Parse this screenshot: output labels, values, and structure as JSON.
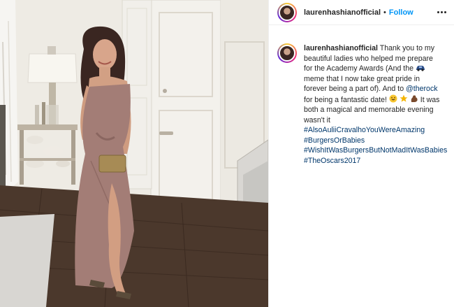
{
  "post": {
    "username": "laurenhashianofficial",
    "separator": "•",
    "follow_label": "Follow",
    "more_icon": "more-horizontal-icon"
  },
  "caption": {
    "username": "laurenhashianofficial",
    "text_1": " Thank you to my beautiful ladies who helped me prepare for the Academy Awards (And the ",
    "emoji_1": "car-icon",
    "text_2": "meme that I now take great pride in forever being a part of). And to ",
    "mention": "@therock",
    "text_3": " for being a fantastic date! ",
    "emojis_2": [
      "grinning-face-icon",
      "star-icon",
      "flexed-biceps-icon"
    ],
    "text_4": " It was both a magical and memorable evening wasn't it ",
    "hashtags": [
      "#AlsoAuliiCravalhoYouWereAmazing",
      "#BurgersOrBabies",
      "#WishItWasBurgersButNotMadItWasBabies",
      "#TheOscars2017"
    ]
  },
  "colors": {
    "follow": "#0095f6",
    "link": "#00376b",
    "text": "#262626"
  }
}
